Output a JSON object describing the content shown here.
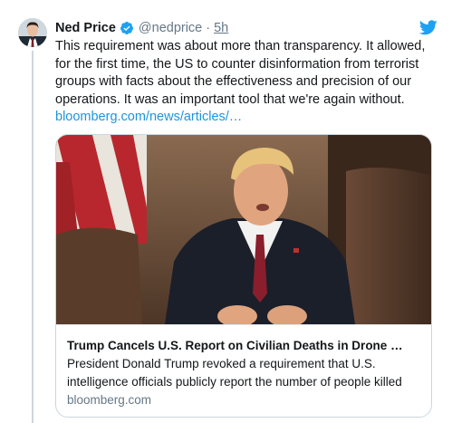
{
  "tweet": {
    "author_name": "Ned Price",
    "handle": "@nedprice",
    "separator": "·",
    "time": "5h",
    "text": "This requirement was about more than transparency. It allowed, for the first time, the US to counter disinformation from terrorist groups with facts about the effectiveness and precision of our operations. It was an important tool that we're again without.",
    "link_text": "bloomberg.com/news/articles/…"
  },
  "card": {
    "title": "Trump Cancels U.S. Report on Civilian Deaths in Drone …",
    "description": "President Donald Trump revoked a requirement that U.S. intelligence officials publicly report the number of people killed",
    "domain": "bloomberg.com"
  },
  "icons": {
    "verified": "verified-badge-icon",
    "brand": "twitter-bird-icon"
  },
  "colors": {
    "link": "#1b95e0",
    "verified": "#1da1f2",
    "secondary_text": "#657786",
    "border": "#ccd6dd"
  }
}
